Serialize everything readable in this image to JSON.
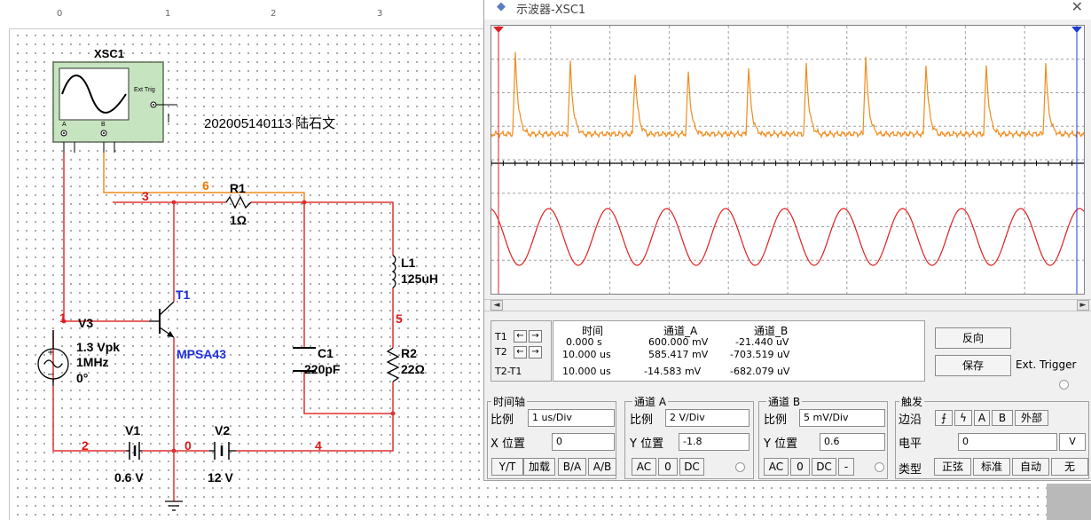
{
  "canvas": {
    "ruler_ticks": [
      "0",
      "1",
      "2",
      "3"
    ]
  },
  "schematic": {
    "scope_ref": "XSC1",
    "scope_ext_trig": "Ext Trig",
    "scope_channel_a": "A",
    "scope_channel_b": "B",
    "annotation": "202005140113 陆石文",
    "r1_name": "R1",
    "r1_value": "1Ω",
    "l1_name": "L1",
    "l1_value": "125uH",
    "r2_name": "R2",
    "r2_value": "22Ω",
    "c1_name": "C1",
    "c1_value": "220pF",
    "t1_name": "T1",
    "t1_model": "MPSA43",
    "v3_name": "V3",
    "v3_amp": "1.3 Vpk",
    "v3_freq": "1MHz",
    "v3_phase": "0°",
    "v1_name": "V1",
    "v1_value": "0.6 V",
    "v2_name": "V2",
    "v2_value": "12 V",
    "net_1": "1",
    "net_2": "2",
    "net_3": "3",
    "net_4": "4",
    "net_5": "5",
    "net_6": "6",
    "net_0": "0"
  },
  "oscilloscope": {
    "title": "示波器-XSC1",
    "close_icon": "close-icon",
    "colors": {
      "channel_a": "#f08c1e",
      "channel_b": "#e02020",
      "cursor_t1": "#e02020",
      "cursor_t2": "#1c3ed0"
    },
    "readout": {
      "headers": [
        "时间",
        "通道_A",
        "通道_B"
      ],
      "rows": [
        {
          "label": "T1",
          "time": "0.000 s",
          "a": "600.000 mV",
          "b": "-21.440 uV"
        },
        {
          "label": "T2",
          "time": "10.000 us",
          "a": "585.417 mV",
          "b": "-703.519 uV"
        },
        {
          "label": "T2-T1",
          "time": "10.000 us",
          "a": "-14.583 mV",
          "b": "-682.079 uV"
        }
      ]
    },
    "buttons": {
      "reverse": "反向",
      "save": "保存",
      "ext_trigger": "Ext. Trigger"
    },
    "timebase": {
      "title": "时间轴",
      "scale_label": "比例",
      "scale_value": "1 us/Div",
      "xpos_label": "X 位置",
      "xpos_value": "0",
      "modes": [
        "Y/T",
        "加载",
        "B/A",
        "A/B"
      ]
    },
    "channel_a": {
      "title": "通道 A",
      "scale_label": "比例",
      "scale_value": "2 V/Div",
      "ypos_label": "Y 位置",
      "ypos_value": "-1.8",
      "couplings": [
        "AC",
        "0",
        "DC"
      ]
    },
    "channel_b": {
      "title": "通道 B",
      "scale_label": "比例",
      "scale_value": "5 mV/Div",
      "ypos_label": "Y 位置",
      "ypos_value": "0.6",
      "couplings": [
        "AC",
        "0",
        "DC",
        "-"
      ]
    },
    "trigger": {
      "title": "触发",
      "edge_label": "边沿",
      "edge_options": [
        "A",
        "B",
        "外部"
      ],
      "level_label": "电平",
      "level_value": "0",
      "level_unit": "V",
      "type_label": "类型",
      "types": [
        "正弦",
        "标准",
        "自动",
        "无"
      ]
    }
  }
}
